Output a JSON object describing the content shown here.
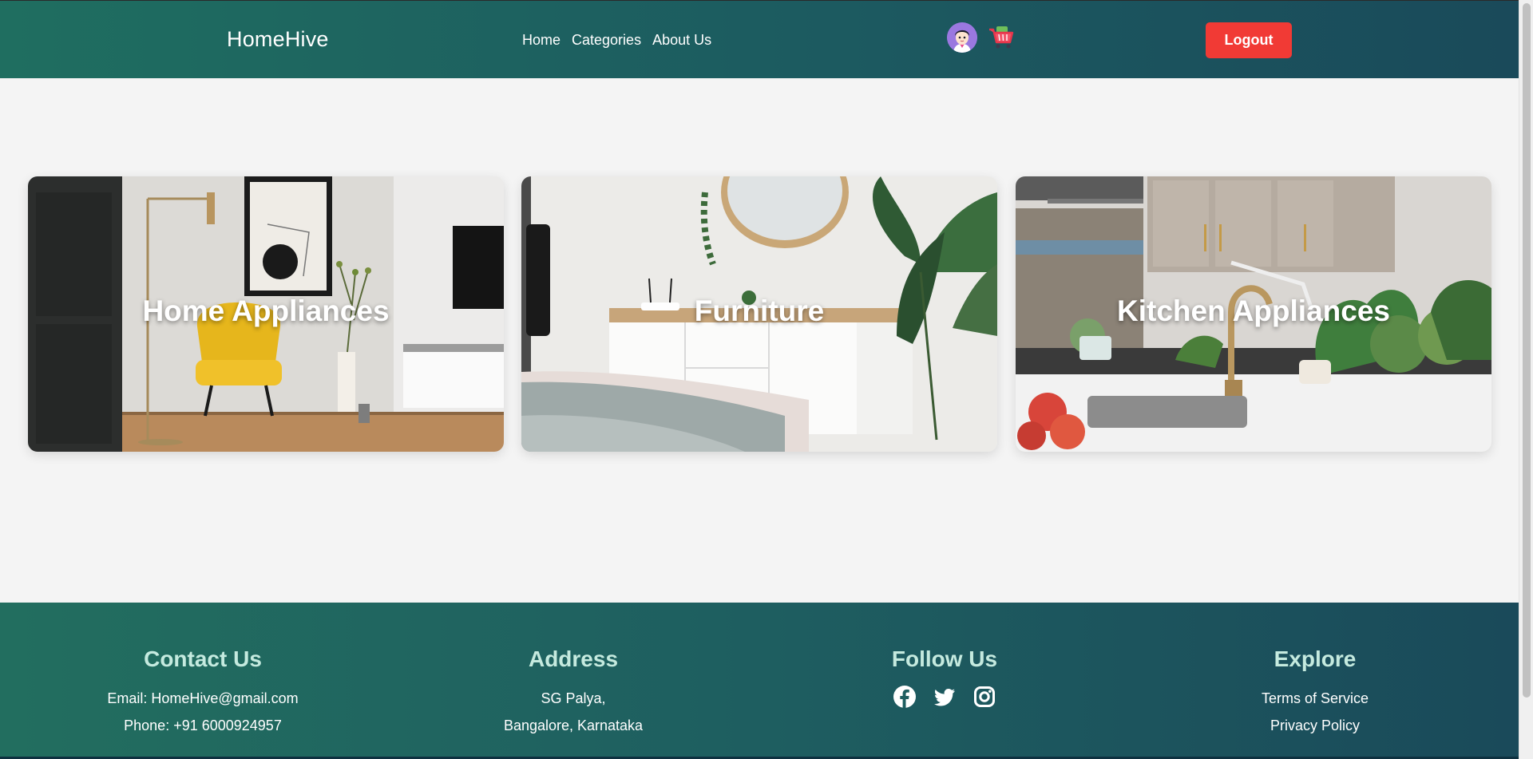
{
  "header": {
    "brand": "HomeHive",
    "nav": [
      "Home",
      "Categories",
      "About Us"
    ],
    "logout_label": "Logout"
  },
  "categories": [
    {
      "title": "Home Appliances"
    },
    {
      "title": "Furniture"
    },
    {
      "title": "Kitchen Appliances"
    }
  ],
  "footer": {
    "contact": {
      "heading": "Contact Us",
      "email": "Email: HomeHive@gmail.com",
      "phone": "Phone: +91 6000924957"
    },
    "address": {
      "heading": "Address",
      "line1": "SG Palya,",
      "line2": "Bangalore, Karnataka"
    },
    "follow": {
      "heading": "Follow Us",
      "icons": [
        "facebook-icon",
        "twitter-icon",
        "instagram-icon"
      ]
    },
    "explore": {
      "heading": "Explore",
      "links": [
        "Terms of Service",
        "Privacy Policy"
      ]
    }
  },
  "colors": {
    "header_gradient_start": "#1f6e60",
    "header_gradient_end": "#1a4a5a",
    "logout_button": "#f13a35",
    "footer_heading": "#c5eadf",
    "page_background": "#f4f4f4"
  }
}
